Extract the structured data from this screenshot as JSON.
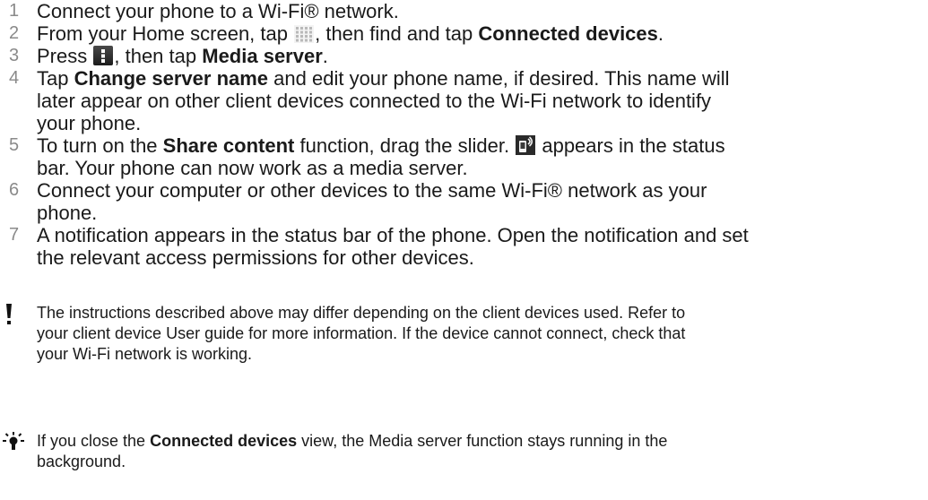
{
  "steps": [
    {
      "number": "1",
      "text": "Connect your phone to a Wi-Fi® network."
    },
    {
      "number": "2",
      "pre": "From your Home screen, tap",
      "mid": ", then find and tap",
      "bold": "Connected devices",
      "post": "."
    },
    {
      "number": "3",
      "pre": "Press",
      "mid": ", then tap",
      "bold": "Media server",
      "post": "."
    },
    {
      "number": "4",
      "pre": "Tap",
      "bold": "Change server name",
      "line1_post": "and edit your phone name, if desired. This name will",
      "line2": "later appear on other client devices connected to the Wi-Fi network to identify",
      "line3": "your phone."
    },
    {
      "number": "5",
      "pre": "To turn on the",
      "bold": "Share content",
      "mid": "function, drag the slider.",
      "line1_post": "appears in the status",
      "line2": "bar. Your phone can now work as a media server."
    },
    {
      "number": "6",
      "line1": "Connect your computer or other devices to the same Wi-Fi® network as your",
      "line2": "phone."
    },
    {
      "number": "7",
      "line1": "A notification appears in the status bar of the phone. Open the notification and set",
      "line2": "the relevant access permissions for other devices."
    }
  ],
  "icons": {
    "step2": "apps-grid-icon",
    "step3": "menu-icon",
    "step5": "media-server-status-icon",
    "warning": "exclamation-icon",
    "tip": "lightbulb-icon"
  },
  "warning_note": {
    "line1": "The instructions described above may differ depending on the client devices used. Refer to",
    "line2": "your client device User guide for more information. If the device cannot connect, check that",
    "line3": "your Wi-Fi network is working."
  },
  "tip_note": {
    "pre": "If you close the",
    "bold": "Connected devices",
    "post": "view, the Media server function stays running in the",
    "line2": "background."
  }
}
